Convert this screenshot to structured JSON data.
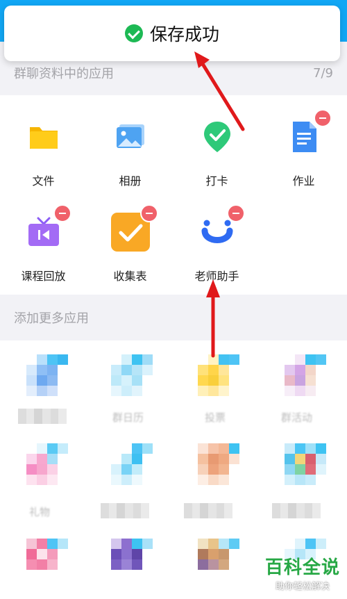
{
  "toast": {
    "text": "保存成功"
  },
  "group_apps": {
    "header": "群聊资料中的应用",
    "count": "7/9",
    "items": [
      {
        "label": "文件",
        "icon": "folder-icon",
        "removable": false
      },
      {
        "label": "相册",
        "icon": "photo-album-icon",
        "removable": false
      },
      {
        "label": "打卡",
        "icon": "check-in-icon",
        "removable": false
      },
      {
        "label": "作业",
        "icon": "homework-icon",
        "removable": true
      },
      {
        "label": "课程回放",
        "icon": "course-replay-icon",
        "removable": true
      },
      {
        "label": "收集表",
        "icon": "collect-form-icon",
        "removable": true
      },
      {
        "label": "老师助手",
        "icon": "teacher-assistant-icon",
        "removable": true
      }
    ]
  },
  "more_apps": {
    "header": "添加更多应用",
    "items": [
      {
        "label": ""
      },
      {
        "label": "群日历"
      },
      {
        "label": "投票"
      },
      {
        "label": "群活动"
      },
      {
        "label": "礼物"
      },
      {
        "label": ""
      },
      {
        "label": ""
      },
      {
        "label": ""
      }
    ]
  },
  "watermark": {
    "main": "百科全说",
    "sub": "助你轻松解决"
  },
  "colors": {
    "topbar": "#12a7f5",
    "badge": "#f0616a",
    "success": "#1db954",
    "arrow": "#e0191b"
  }
}
